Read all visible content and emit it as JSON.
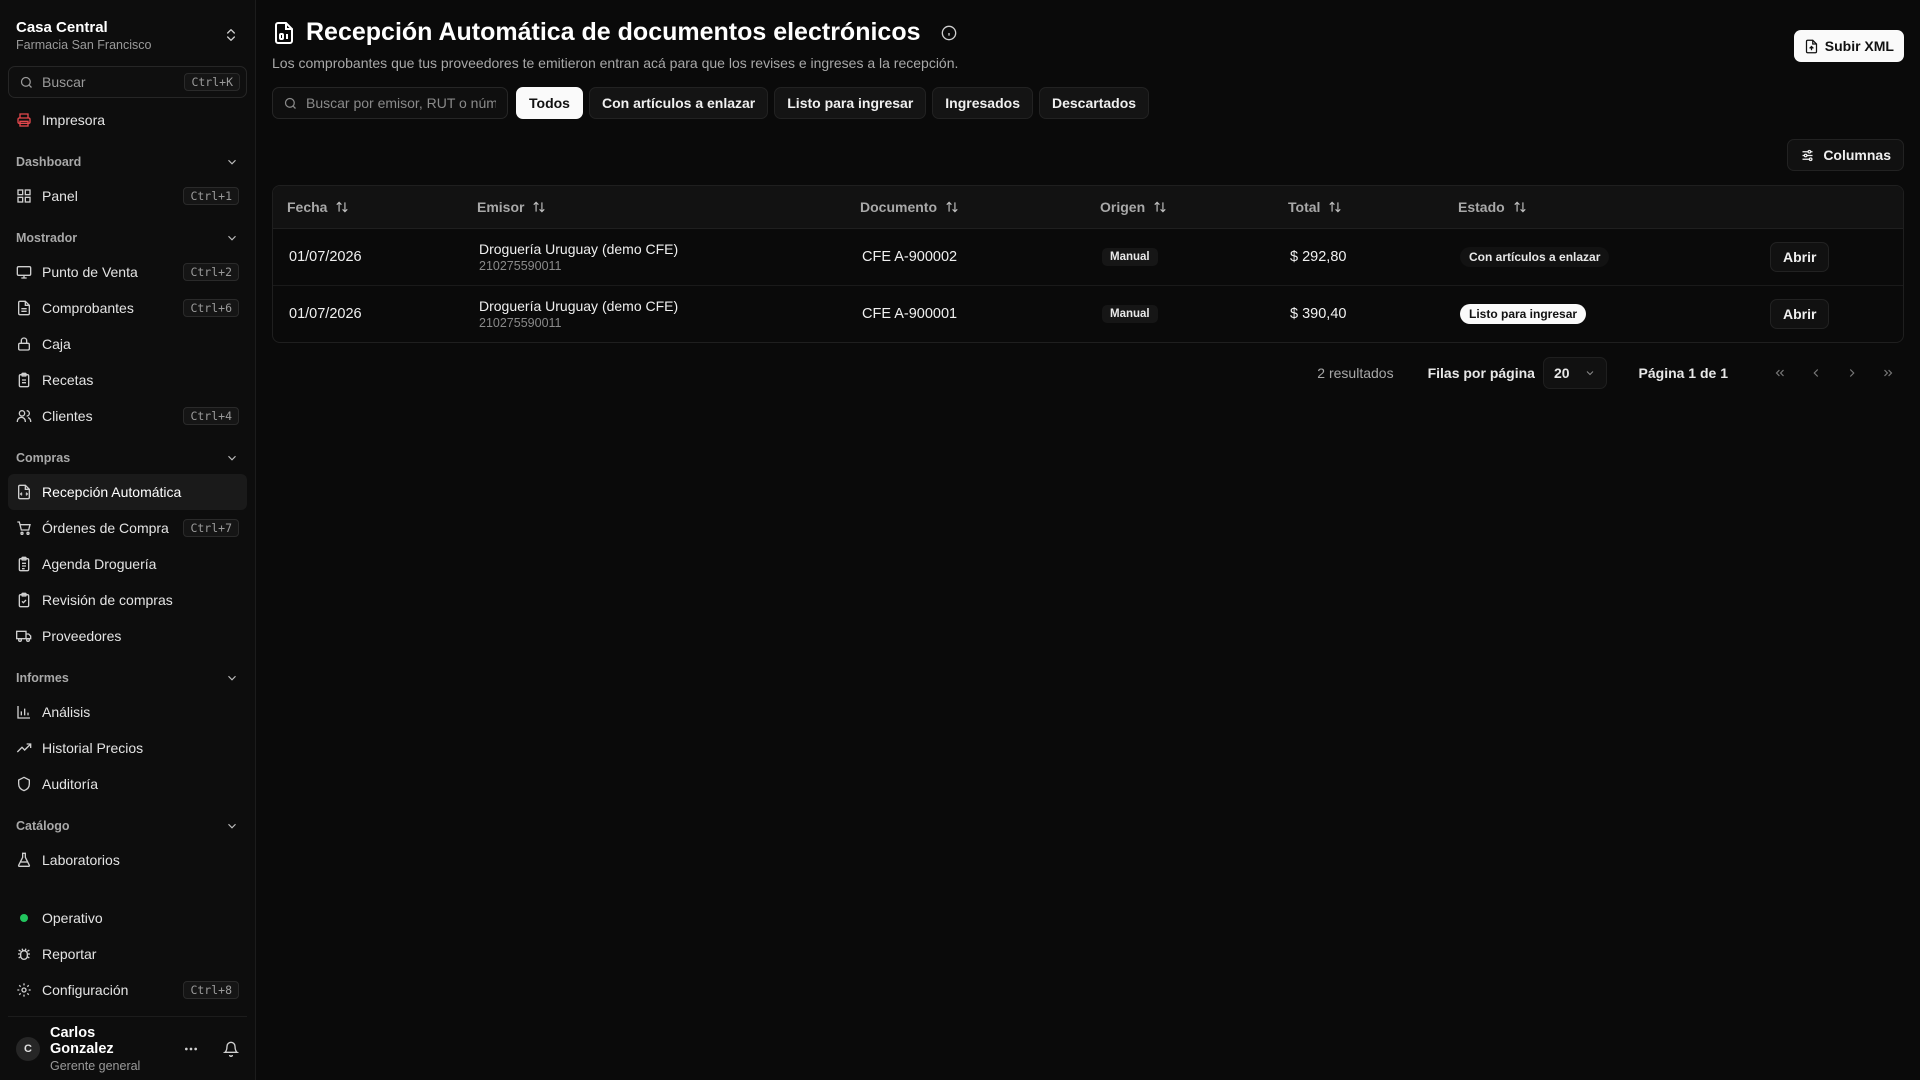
{
  "org": {
    "name": "Casa Central",
    "subtitle": "Farmacia San Francisco"
  },
  "search": {
    "placeholder": "Buscar",
    "shortcut": "Ctrl+K"
  },
  "printer": {
    "label": "Impresora",
    "color": "#e5484d"
  },
  "sections": {
    "dashboard": {
      "title": "Dashboard",
      "items": [
        {
          "label": "Panel",
          "shortcut": "Ctrl+1"
        }
      ]
    },
    "mostrador": {
      "title": "Mostrador",
      "items": [
        {
          "label": "Punto de Venta",
          "shortcut": "Ctrl+2"
        },
        {
          "label": "Comprobantes",
          "shortcut": "Ctrl+6"
        },
        {
          "label": "Caja"
        },
        {
          "label": "Recetas"
        },
        {
          "label": "Clientes",
          "shortcut": "Ctrl+4"
        }
      ]
    },
    "compras": {
      "title": "Compras",
      "items": [
        {
          "label": "Recepción Automática"
        },
        {
          "label": "Órdenes de Compra",
          "shortcut": "Ctrl+7"
        },
        {
          "label": "Agenda Droguería"
        },
        {
          "label": "Revisión de compras"
        },
        {
          "label": "Proveedores"
        }
      ]
    },
    "informes": {
      "title": "Informes",
      "items": [
        {
          "label": "Análisis"
        },
        {
          "label": "Historial Precios"
        },
        {
          "label": "Auditoría"
        }
      ]
    },
    "catalogo": {
      "title": "Catálogo",
      "items": [
        {
          "label": "Laboratorios"
        }
      ]
    }
  },
  "footer_nav": {
    "status": {
      "label": "Operativo",
      "color": "#22c55e"
    },
    "report": {
      "label": "Reportar"
    },
    "settings": {
      "label": "Configuración",
      "shortcut": "Ctrl+8"
    }
  },
  "user": {
    "initial": "C",
    "name": "Carlos Gonzalez",
    "role": "Gerente general"
  },
  "page": {
    "title": "Recepción Automática de documentos electrónicos",
    "subtitle": "Los comprobantes que tus proveedores te emitieron entran acá para que los revises e ingreses a la recepción.",
    "upload_label": "Subir XML"
  },
  "filters": {
    "search_placeholder": "Buscar por emisor, RUT o número",
    "tabs": [
      "Todos",
      "Con artículos a enlazar",
      "Listo para ingresar",
      "Ingresados",
      "Descartados"
    ],
    "active_tab": "Todos"
  },
  "columns_button": "Columnas",
  "table": {
    "headers": [
      "Fecha",
      "Emisor",
      "Documento",
      "Origen",
      "Total",
      "Estado"
    ],
    "rows": [
      {
        "fecha": "01/07/2026",
        "emisor": "Droguería Uruguay (demo CFE)",
        "rut": "210275590011",
        "documento": "CFE A-900002",
        "origen": "Manual",
        "total": "$ 292,80",
        "estado": "Con artículos a enlazar",
        "action": "Abrir"
      },
      {
        "fecha": "01/07/2026",
        "emisor": "Droguería Uruguay (demo CFE)",
        "rut": "210275590011",
        "documento": "CFE A-900001",
        "origen": "Manual",
        "total": "$ 390,40",
        "estado": "Listo para ingresar",
        "action": "Abrir"
      }
    ]
  },
  "pagination": {
    "results": "2 resultados",
    "rows_per_page_label": "Filas por página",
    "rows_per_page": "20",
    "page_label": "Página 1 de 1"
  }
}
